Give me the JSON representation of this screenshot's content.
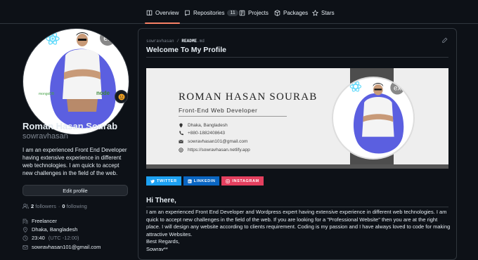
{
  "tabs": [
    {
      "label": "Overview"
    },
    {
      "label": "Repositories",
      "count": "11"
    },
    {
      "label": "Projects"
    },
    {
      "label": "Packages"
    },
    {
      "label": "Stars"
    }
  ],
  "profile": {
    "name": "Roman Hasan Sourab",
    "username": "sowravhasan",
    "bio": "I am an experienced Front End Developer having extensive experience in different web technologies. I am quick to accept new challenges in the field of the web.",
    "edit_label": "Edit profile",
    "followers": "2",
    "followers_label": "followers",
    "dot": "·",
    "following": "0",
    "following_label": "following",
    "company": "Freelancer",
    "location": "Dhaka, Bangladesh",
    "time": "23:40",
    "timezone": "(UTC -12:00)",
    "email": "sowravhasan101@gmail.com",
    "avatar_badges": {
      "ex": "ex",
      "mongo": "mongoDB",
      "node": "node"
    }
  },
  "readme": {
    "path_user": "sowravhasan",
    "path_sep": " / ",
    "path_file": "README",
    "path_ext": ".md",
    "title": "Welcome To My Profile",
    "banner": {
      "name": "ROMAN HASAN SOURAB",
      "role": "Front-End Web Developer",
      "location": "Dhaka, Bangladesh",
      "phone": "+880-1882408643",
      "email": "sowravhasan101@gmail.com",
      "website": "https://sowravhasan.netlify.app",
      "ex": "ex"
    },
    "badges": [
      {
        "label": "TWITTER",
        "color": "#1da1f2",
        "icon": "twitter-icon"
      },
      {
        "label": "LINKEDIN",
        "color": "#0a66c2",
        "icon": "linkedin-icon"
      },
      {
        "label": "INSTAGRAM",
        "color": "#e4405f",
        "icon": "instagram-icon"
      }
    ],
    "greeting": "Hi There,",
    "paragraph": "I am an experienced Front End Developer and Wordpress expert having extensive experience in different web technologies. I am quick to accept new challenges in the field of the web. If you are looking for a \"Professional Website\" then you are at the right place. I will design any website according to clients requirement. Coding is my passion and I have always loved to code for making attractive Websites.",
    "regards": "Best Regards,",
    "signoff": "Sowrav**"
  },
  "colors": {
    "accent": "#f78166",
    "bg": "#0d1117",
    "border": "#30363d",
    "muted": "#7d8590"
  }
}
